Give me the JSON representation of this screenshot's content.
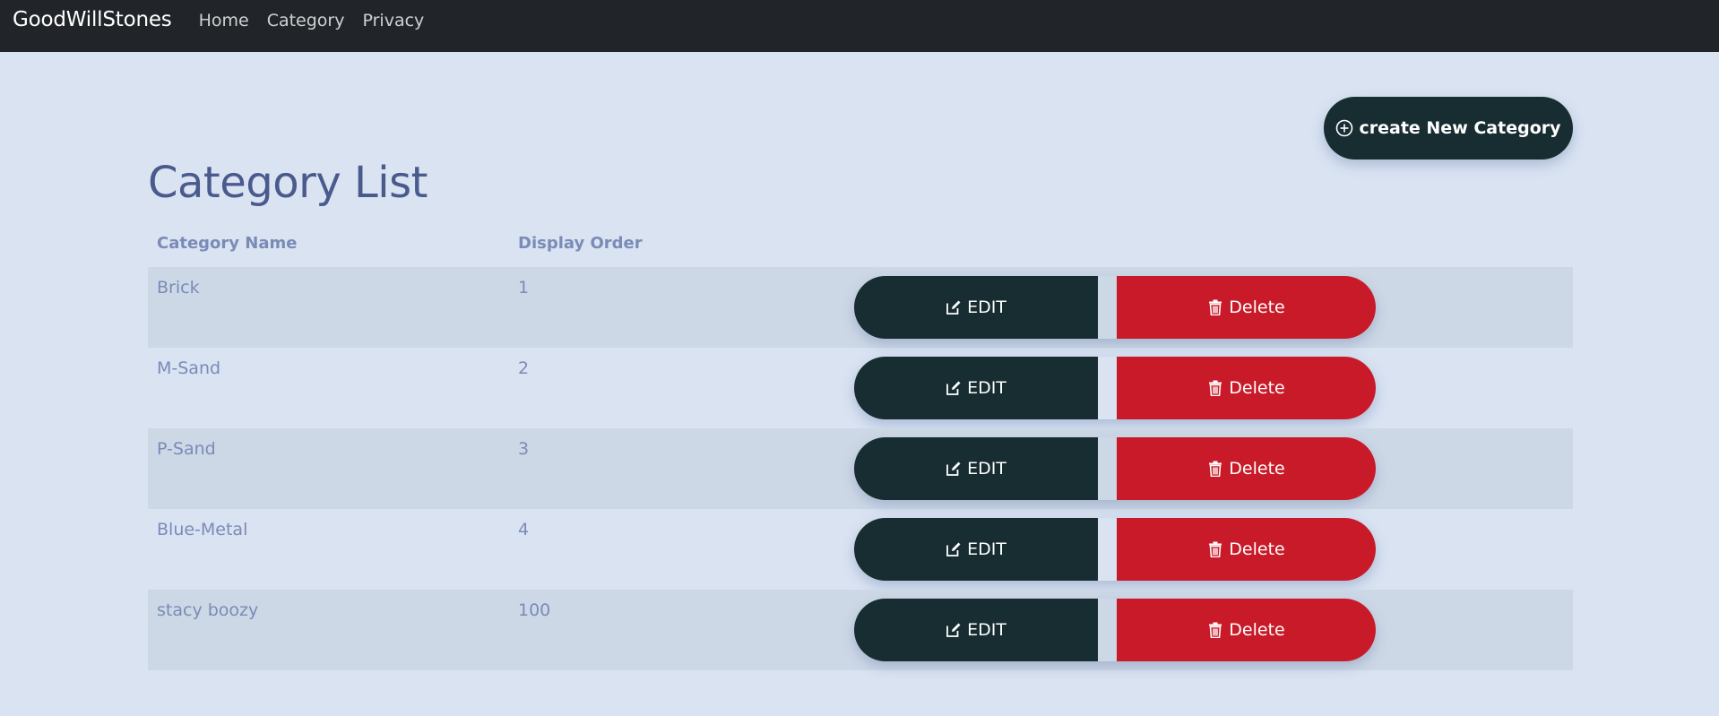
{
  "navbar": {
    "brand": "GoodWillStones",
    "links": [
      {
        "label": "Home"
      },
      {
        "label": "Category"
      },
      {
        "label": "Privacy"
      }
    ]
  },
  "create_button": {
    "label": "create New Category",
    "icon": "plus-circle-icon"
  },
  "page_title": "Category List",
  "table": {
    "headers": [
      "Category Name",
      "Display Order"
    ],
    "rows": [
      {
        "name": "Brick",
        "order": "1"
      },
      {
        "name": "M-Sand",
        "order": "2"
      },
      {
        "name": "P-Sand",
        "order": "3"
      },
      {
        "name": "Blue-Metal",
        "order": "4"
      },
      {
        "name": "stacy boozy",
        "order": "100"
      }
    ],
    "edit_label": "EDIT",
    "delete_label": "Delete",
    "edit_icon": "pencil-square-icon",
    "delete_icon": "trash-icon"
  },
  "colors": {
    "background": "#d9e3f2",
    "navbar": "#212529",
    "dark_button": "#172d31",
    "danger_button": "#c81a28",
    "title": "#4a5a8c",
    "muted_text": "#7a8bb6",
    "striped_row": "#cdd8e6"
  }
}
